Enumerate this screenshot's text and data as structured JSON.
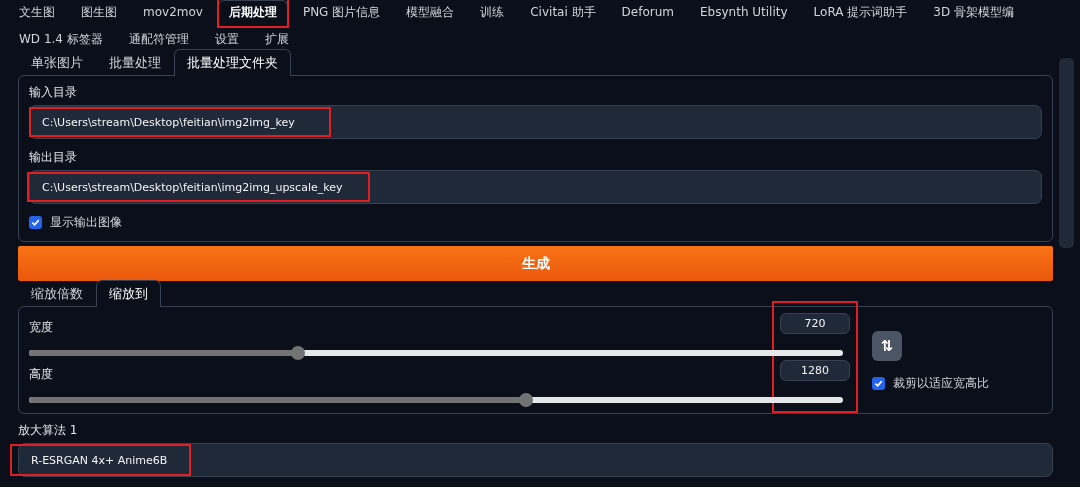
{
  "main_tabs": [
    {
      "label": "文生图",
      "selected": false,
      "highlighted": false
    },
    {
      "label": "图生图",
      "selected": false,
      "highlighted": false
    },
    {
      "label": "mov2mov",
      "selected": false,
      "highlighted": false
    },
    {
      "label": "后期处理",
      "selected": true,
      "highlighted": true
    },
    {
      "label": "PNG 图片信息",
      "selected": false,
      "highlighted": false
    },
    {
      "label": "模型融合",
      "selected": false,
      "highlighted": false
    },
    {
      "label": "训练",
      "selected": false,
      "highlighted": false
    },
    {
      "label": "Civitai 助手",
      "selected": false,
      "highlighted": false
    },
    {
      "label": "Deforum",
      "selected": false,
      "highlighted": false
    },
    {
      "label": "Ebsynth Utility",
      "selected": false,
      "highlighted": false
    },
    {
      "label": "LoRA 提示词助手",
      "selected": false,
      "highlighted": false
    },
    {
      "label": "3D 骨架模型编",
      "selected": false,
      "highlighted": false
    },
    {
      "label": "WD 1.4 标签器",
      "selected": false,
      "highlighted": false
    },
    {
      "label": "通配符管理",
      "selected": false,
      "highlighted": false
    },
    {
      "label": "设置",
      "selected": false,
      "highlighted": false
    },
    {
      "label": "扩展",
      "selected": false,
      "highlighted": false
    }
  ],
  "source_tabs": [
    {
      "label": "单张图片",
      "selected": false
    },
    {
      "label": "批量处理",
      "selected": false
    },
    {
      "label": "批量处理文件夹",
      "selected": true
    }
  ],
  "directories": [
    {
      "label": "输入目录",
      "value": "C:\\Users\\stream\\Desktop\\feitian\\img2img_key",
      "highlighted": true
    },
    {
      "label": "输出目录",
      "value": "C:\\Users\\stream\\Desktop\\feitian\\img2img_upscale_key",
      "highlighted": true
    }
  ],
  "show_output": {
    "label": "显示输出图像",
    "checked": true
  },
  "generate_button": "生成",
  "resize_tabs": [
    {
      "label": "缩放倍数",
      "selected": false
    },
    {
      "label": "缩放到",
      "selected": true
    }
  ],
  "resize": {
    "numbers_highlighted": true,
    "sliders": [
      {
        "label": "宽度",
        "value": "720",
        "level": 0.33
      },
      {
        "label": "高度",
        "value": "1280",
        "level": 0.61
      }
    ],
    "swap_button": "⇅",
    "crop": {
      "label": "裁剪以适应宽高比",
      "checked": true
    }
  },
  "upscaler": {
    "label": "放大算法 1",
    "value": "R-ESRGAN 4x+ Anime6B",
    "highlighted": true
  }
}
